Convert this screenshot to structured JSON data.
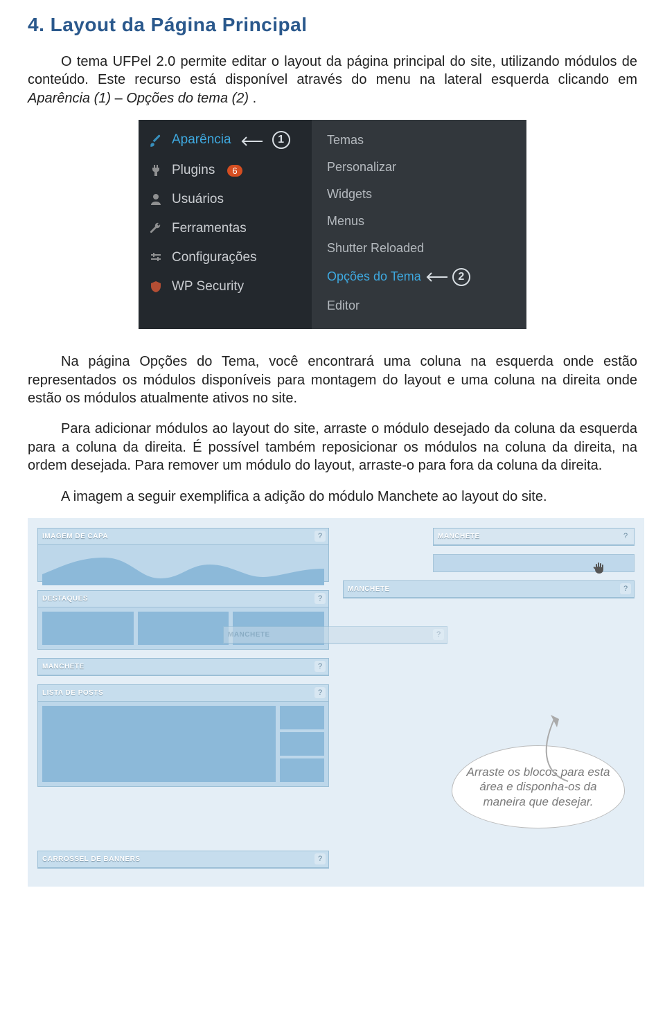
{
  "heading": "4. Layout da Página Principal",
  "p1a": "O tema UFPel 2.0 permite editar o layout da página principal do site, utilizando módulos de conteúdo. Este recurso está disponível através do menu na lateral esquerda clicando em ",
  "p1e1": "Aparência (1)",
  "p1b": " – ",
  "p1e2": "Opções do tema (2)",
  "p1c": ".",
  "wp": {
    "left": [
      {
        "icon": "brush",
        "label": "Aparência",
        "active": true,
        "marker": "1"
      },
      {
        "icon": "plug",
        "label": "Plugins",
        "badge": "6"
      },
      {
        "icon": "user",
        "label": "Usuários"
      },
      {
        "icon": "wrench",
        "label": "Ferramentas"
      },
      {
        "icon": "sliders",
        "label": "Configurações"
      },
      {
        "icon": "shield",
        "label": "WP Security"
      }
    ],
    "right": [
      {
        "label": "Temas"
      },
      {
        "label": "Personalizar"
      },
      {
        "label": "Widgets"
      },
      {
        "label": "Menus"
      },
      {
        "label": "Shutter Reloaded"
      },
      {
        "label": "Opções do Tema",
        "hl": true,
        "marker": "2"
      },
      {
        "label": "Editor"
      }
    ]
  },
  "p2": "Na página Opções do Tema, você encontrará uma coluna na esquerda onde estão representados os módulos disponíveis para montagem do layout e uma coluna na direita onde estão os módulos atualmente ativos no site.",
  "p3": "Para adicionar módulos ao layout do site, arraste o módulo desejado da coluna da esquerda para a coluna da direita. É possível também reposicionar os módulos na coluna da direita, na ordem desejada. Para remover um módulo do layout, arraste-o para fora da coluna da direita.",
  "p4": "A imagem a seguir exemplifica a adição do módulo Manchete ao layout do site.",
  "builder": {
    "q": "?",
    "left_blocks": [
      "IMAGEM DE CAPA",
      "DESTAQUES",
      "MANCHETE",
      "LISTA DE POSTS",
      "CARROSSEL DE BANNERS"
    ],
    "right_blocks": [
      "MANCHETE",
      "MANCHETE"
    ],
    "drag_block": "MANCHETE",
    "bubble": "Arraste os blocos para esta área e disponha-os da maneira que desejar."
  }
}
